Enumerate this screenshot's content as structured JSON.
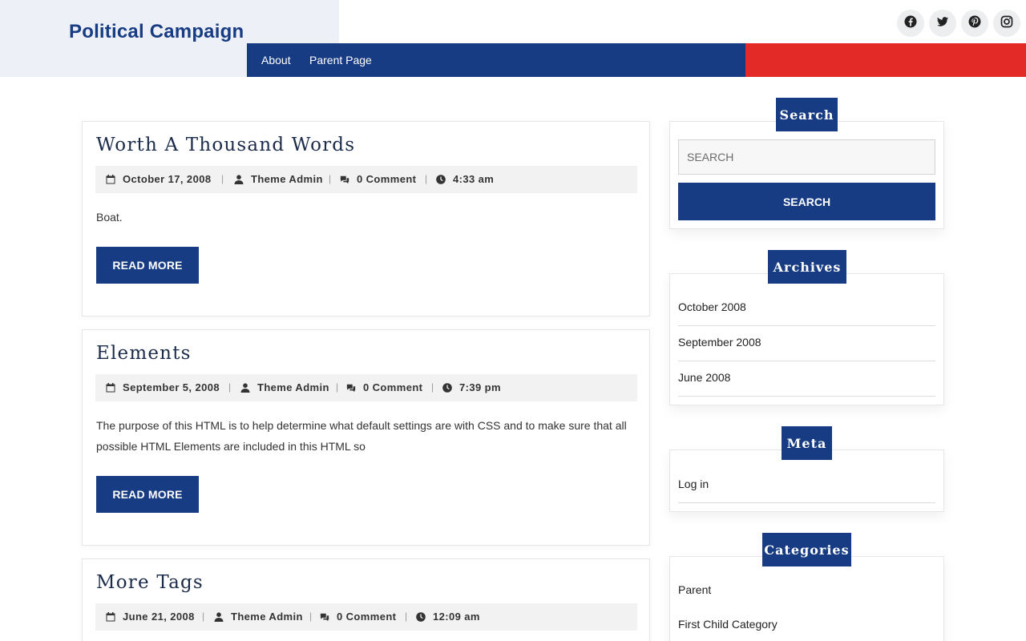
{
  "header": {
    "site_title": "Political Campaign",
    "nav": [
      "About",
      "Parent Page"
    ],
    "social_icons": [
      "facebook-icon",
      "twitter-icon",
      "pinterest-icon",
      "instagram-icon"
    ]
  },
  "posts": [
    {
      "title": "Worth A Thousand Words",
      "date": "October 17, 2008",
      "author": "Theme Admin",
      "comments": "0 Comment",
      "time": "4:33 am",
      "excerpt": "Boat.",
      "read_more": "READ MORE"
    },
    {
      "title": "Elements",
      "date": "September 5, 2008",
      "author": "Theme Admin",
      "comments": "0 Comment",
      "time": "7:39 pm",
      "excerpt": "The purpose of this HTML is to help determine what default settings are with CSS and to make sure that all possible HTML Elements are included in this HTML so",
      "read_more": "READ MORE"
    },
    {
      "title": "More Tags",
      "date": "June 21, 2008",
      "author": "Theme Admin",
      "comments": "0 Comment",
      "time": "12:09 am"
    }
  ],
  "sidebar": {
    "search": {
      "title": "Search",
      "placeholder": "SEARCH",
      "button": "SEARCH"
    },
    "archives": {
      "title": "Archives",
      "items": [
        "October 2008",
        "September 2008",
        "June 2008"
      ]
    },
    "meta": {
      "title": "Meta",
      "items": [
        "Log in"
      ]
    },
    "categories": {
      "title": "Categories",
      "items": [
        "Parent",
        "First Child Category"
      ]
    }
  },
  "colors": {
    "primary": "#173c84",
    "accent_red": "#e32a27",
    "brand_bg": "#edf1f7"
  }
}
